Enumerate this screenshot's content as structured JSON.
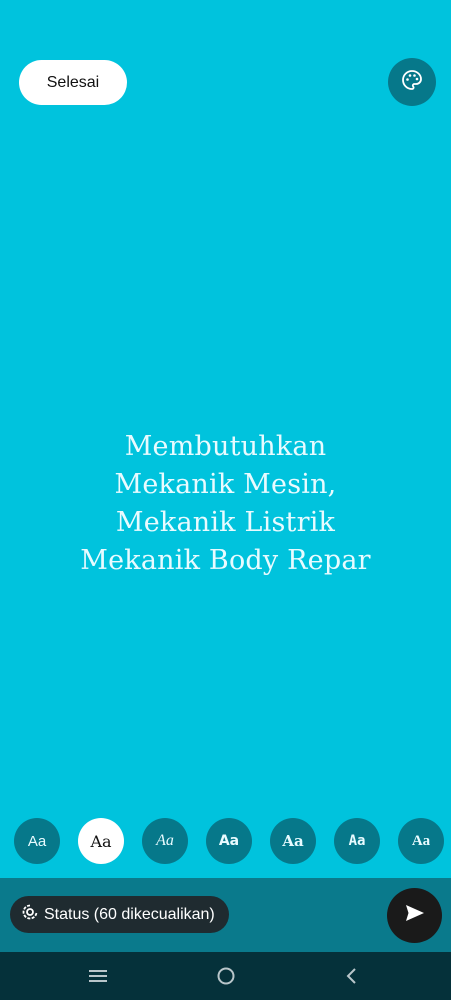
{
  "header": {
    "done_label": "Selesai",
    "palette_icon": "palette-icon"
  },
  "status": {
    "background_color": "#00C3DD",
    "lines": [
      "Membutuhkan",
      "Mekanik Mesin,",
      "Mekanik Listrik",
      "Mekanik Body Repar"
    ]
  },
  "font_options": {
    "items": [
      {
        "label": "Aa",
        "selected": false
      },
      {
        "label": "Aa",
        "selected": true
      },
      {
        "label": "Aa",
        "selected": false
      },
      {
        "label": "Aa",
        "selected": false
      },
      {
        "label": "Aa",
        "selected": false
      },
      {
        "label": "Aa",
        "selected": false
      },
      {
        "label": "Aa",
        "selected": false
      }
    ]
  },
  "footer": {
    "audience_label": "Status (60 dikecualikan)",
    "audience_icon": "status-ring-icon",
    "send_icon": "send-icon"
  },
  "nav": {
    "recents_icon": "recents-icon",
    "home_icon": "home-icon",
    "back_icon": "back-icon"
  }
}
